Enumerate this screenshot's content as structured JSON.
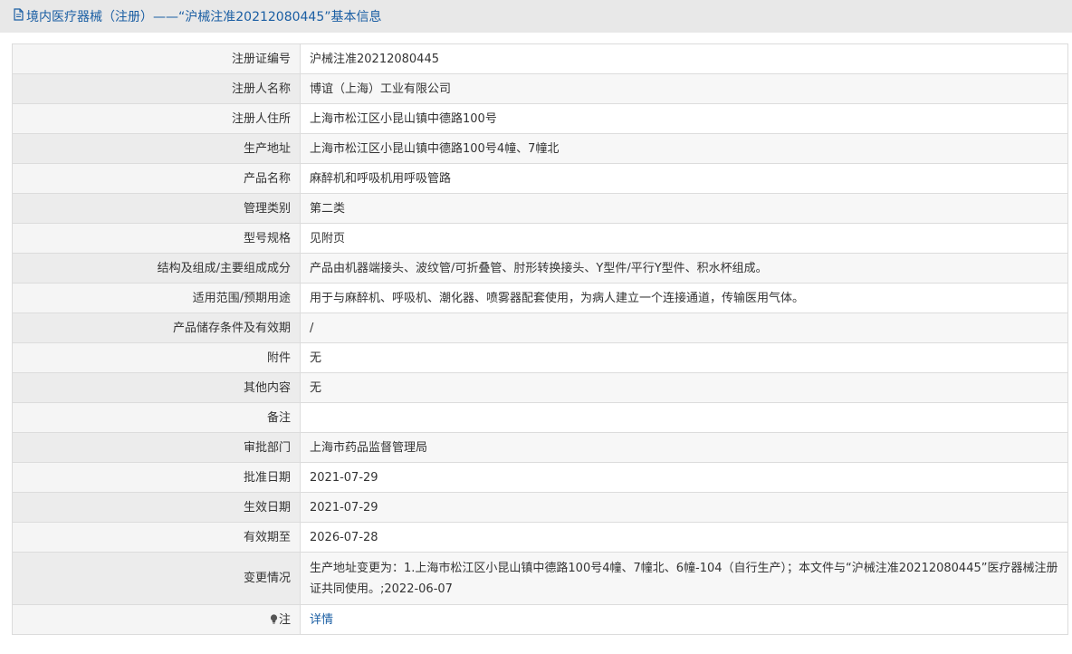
{
  "header": {
    "icon": "document-icon",
    "title": "境内医疗器械（注册）——“沪械注准20212080445”基本信息"
  },
  "rows": [
    {
      "label": "注册证编号",
      "value": "沪械注准20212080445"
    },
    {
      "label": "注册人名称",
      "value": "博谊（上海）工业有限公司"
    },
    {
      "label": "注册人住所",
      "value": "上海市松江区小昆山镇中德路100号"
    },
    {
      "label": "生产地址",
      "value": "上海市松江区小昆山镇中德路100号4幢、7幢北"
    },
    {
      "label": "产品名称",
      "value": "麻醉机和呼吸机用呼吸管路"
    },
    {
      "label": "管理类别",
      "value": "第二类"
    },
    {
      "label": "型号规格",
      "value": "见附页"
    },
    {
      "label": "结构及组成/主要组成成分",
      "value": "产品由机器端接头、波纹管/可折叠管、肘形转换接头、Y型件/平行Y型件、积水杯组成。"
    },
    {
      "label": "适用范围/预期用途",
      "value": "用于与麻醉机、呼吸机、潮化器、喷雾器配套使用，为病人建立一个连接通道，传输医用气体。"
    },
    {
      "label": "产品储存条件及有效期",
      "value": "/"
    },
    {
      "label": "附件",
      "value": "无"
    },
    {
      "label": "其他内容",
      "value": "无"
    },
    {
      "label": "备注",
      "value": ""
    },
    {
      "label": "审批部门",
      "value": "上海市药品监督管理局"
    },
    {
      "label": "批准日期",
      "value": "2021-07-29"
    },
    {
      "label": "生效日期",
      "value": "2021-07-29"
    },
    {
      "label": "有效期至",
      "value": "2026-07-28"
    },
    {
      "label": "变更情况",
      "value": "生产地址变更为：1.上海市松江区小昆山镇中德路100号4幢、7幢北、6幢-104（自行生产）；本文件与“沪械注准20212080445”医疗器械注册证共同使用。;2022-06-07"
    }
  ],
  "note": {
    "icon": "lightbulb-icon",
    "label": "注",
    "link_text": "详情"
  }
}
